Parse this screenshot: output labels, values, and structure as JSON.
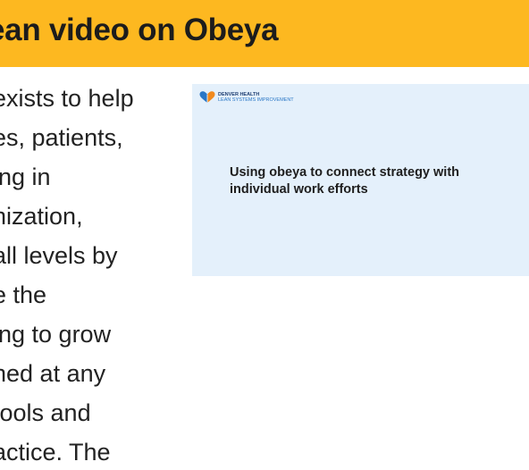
{
  "banner": {
    "title": "ean video on Obeya",
    "color": "#fdb820"
  },
  "body": {
    "lines": [
      "exists to help",
      "es, patients,",
      "ing in",
      "nization,",
      "all levels by",
      "e the",
      "ing to grow",
      "hed at any",
      " tools and",
      "actice. The"
    ]
  },
  "video": {
    "background": "#e4f0fb",
    "logo": {
      "icon": "heart-logo-icon",
      "line1": "DENVER HEALTH",
      "line2": "LEAN SYSTEMS IMPROVEMENT"
    },
    "title": "Using obeya to connect strategy with individual work efforts"
  }
}
